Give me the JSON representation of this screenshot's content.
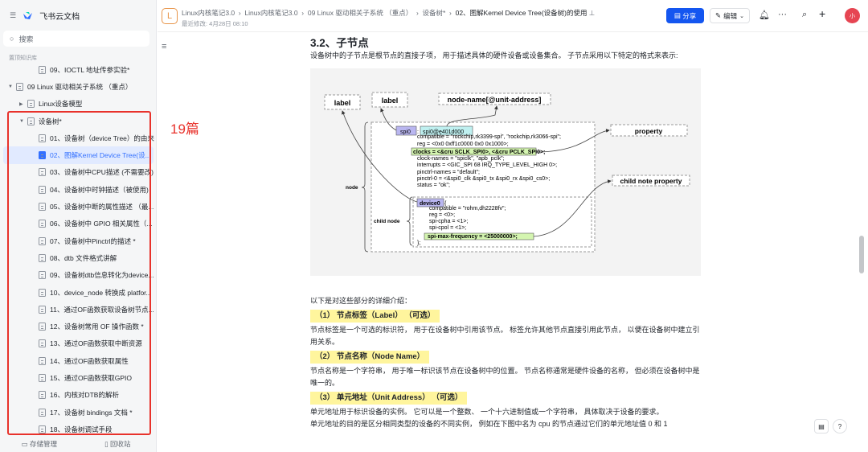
{
  "app": {
    "name": "飞书云文档",
    "search_placeholder": "搜索",
    "section_label": "置顶知识库"
  },
  "sidebar": {
    "items": [
      {
        "label": "09、IOCTL 地址传参实验*",
        "indent": 2,
        "caret": ""
      },
      {
        "label": "09 Linux 驱动相关子系统 （重点）",
        "indent": 0,
        "caret": "▼"
      },
      {
        "label": "Linux设备模型",
        "indent": 1,
        "caret": "▶"
      },
      {
        "label": "设备树*",
        "indent": 1,
        "caret": "▼"
      },
      {
        "label": "01、设备树（device Tree）的由来",
        "indent": 2,
        "caret": ""
      },
      {
        "label": "02、图解Kernel Device Tree(设...",
        "indent": 2,
        "caret": "",
        "active": true
      },
      {
        "label": "03、设备树中CPU描述 (不需要改)",
        "indent": 2,
        "caret": ""
      },
      {
        "label": "04、设备树中时钟描述（被使用)",
        "indent": 2,
        "caret": ""
      },
      {
        "label": "05、设备树中断的属性描述 （最...",
        "indent": 2,
        "caret": ""
      },
      {
        "label": "06、设备树中 GPIO 相关属性（...",
        "indent": 2,
        "caret": ""
      },
      {
        "label": "07、设备树中Pinctrl的描述 *",
        "indent": 2,
        "caret": ""
      },
      {
        "label": "08、dtb 文件格式讲解",
        "indent": 2,
        "caret": ""
      },
      {
        "label": "09、设备树dtb信息转化为device...",
        "indent": 2,
        "caret": ""
      },
      {
        "label": "10、device_node 转换成 platfor...",
        "indent": 2,
        "caret": ""
      },
      {
        "label": "11、通过OF函数获取设备树节点...",
        "indent": 2,
        "caret": ""
      },
      {
        "label": "12、设备树常用 OF 操作函数 *",
        "indent": 2,
        "caret": ""
      },
      {
        "label": "13、通过OF函数获取中断资源",
        "indent": 2,
        "caret": ""
      },
      {
        "label": "14、通过OF函数获取属性",
        "indent": 2,
        "caret": ""
      },
      {
        "label": "15、通过OF函数获取GPIO",
        "indent": 2,
        "caret": ""
      },
      {
        "label": "16、内核对DTB的解析",
        "indent": 2,
        "caret": ""
      },
      {
        "label": "17、设备树 bindings 文档 *",
        "indent": 2,
        "caret": ""
      },
      {
        "label": "18、设备树调试手段",
        "indent": 2,
        "caret": ""
      }
    ],
    "footer": {
      "storage": "存储管理",
      "trash": "回收站"
    }
  },
  "annotation": "19篇",
  "header": {
    "logo_letter": "L",
    "breadcrumbs": [
      "Linux内核笔记3.0",
      "Linux内核笔记3.0",
      "09 Linux 驱动相关子系统 （重点）",
      "设备树*",
      "02、图解Kernel Device Tree(设备树)的使用"
    ],
    "modified": "最近修改: 4月28日 08:10",
    "share": "分享",
    "edit": "编辑",
    "avatar": "小"
  },
  "doc": {
    "heading": "3.2、子节点",
    "intro": "设备树中的子节点是根节点的直接子项， 用于描述具体的硬件设备或设备集合。 子节点采用以下特定的格式来表示:",
    "diagram": {
      "label1": "label",
      "label2": "label",
      "node_name": "node-name[@unit-address]",
      "spi0": "spi0",
      "spi0_addr": "spi0@e401d000",
      "lines": [
        "compatible = \"rockchip,rk3399-spi\", \"rockchip,rk3066-spi\";",
        "reg = <0x0 0xff1c0000 0x0 0x1000>;",
        "clocks = <&cru SCLK_SPI0>, <&cru PCLK_SPI0>;",
        "clock-names = \"spiclk\", \"apb_pclk\";",
        "interrupts = <GIC_SPI 68 IRQ_TYPE_LEVEL_HIGH 0>;",
        "pinctrl-names = \"default\";",
        "pinctrl-0 = <&spi0_clk &spi0_tx &spi0_rx &spi0_cs0>;",
        "status = \"ok\";"
      ],
      "device0": "device0",
      "device0_brace": "{",
      "child_lines": [
        "compatible = \"rohm,dh2228fv\";",
        "reg = <0>;",
        "spi-cpha = <1>;",
        "spi-cpol = <1>;",
        "spi-max-frequency = <25000000>;"
      ],
      "close": "};",
      "node": "node",
      "child_node": "child node",
      "property": "property",
      "child_property": "child note property"
    },
    "details_intro": "以下是对这些部分的详细介绍：",
    "s1_title": "（1） 节点标签（Label） （可选）",
    "s1_body": "节点标签是一个可选的标识符， 用于在设备树中引用该节点。 标签允许其他节点直接引用此节点， 以便在设备树中建立引用关系。",
    "s2_title": "（2） 节点名称（Node Name）",
    "s2_body": "节点名称是一个字符串， 用于唯一标识该节点在设备树中的位置。 节点名称通常是硬件设备的名称， 但必须在设备树中是唯一的。",
    "s3_title": "（3） 单元地址（Unit Address） （可选）",
    "s3_body": " 单元地址用于标识设备的实例。 它可以是一个整数、 一个十六进制值或一个字符串， 具体取决于设备的要求。",
    "s3_body2": "单元地址的目的是区分相同类型的设备的不同实例， 例如在下图中名为 cpu 的节点通过它们的单元地址值 0 和 1"
  },
  "colors": {
    "accent": "#1456f0",
    "annotation": "#e8322b",
    "highlight": "#fff59d"
  }
}
